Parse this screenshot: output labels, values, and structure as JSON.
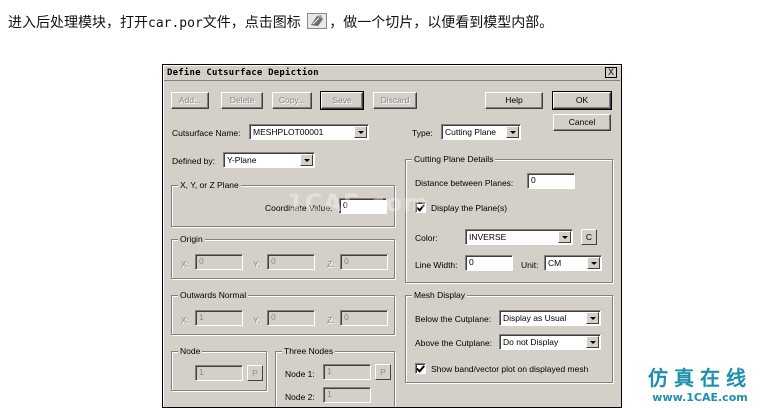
{
  "intro": {
    "part1": "进入后处理模块，打开",
    "filename": "car.por",
    "part2": "文件，点击图标",
    "part3": "，做一个切片，以便看到模型内部。"
  },
  "icons": {
    "inline_tool": "cutsurface-tool-icon",
    "close": "close-icon"
  },
  "dialog": {
    "title": "Define Cutsurface Depiction",
    "close_label": "X",
    "toolbar": {
      "add": "Add...",
      "delete": "Delete",
      "copy": "Copy...",
      "save": "Save",
      "discard": "Discard",
      "help": "Help",
      "ok": "OK",
      "cancel": "Cancel"
    },
    "cutsurface_name": {
      "label": "Cutsurface Name:",
      "value": "MESHPLOT00001"
    },
    "type": {
      "label": "Type:",
      "value": "Cutting Plane"
    },
    "defined_by": {
      "label": "Defined by:",
      "value": "Y-Plane"
    },
    "xyz_plane": {
      "title": "X, Y, or Z Plane",
      "coord_label": "Coordinate Value:",
      "coord_value": "0"
    },
    "origin": {
      "title": "Origin",
      "x_label": "X:",
      "x_value": "0",
      "y_label": "Y:",
      "y_value": "0",
      "z_label": "Z:",
      "z_value": "0"
    },
    "outwards_normal": {
      "title": "Outwards Normal",
      "x_label": "X:",
      "x_value": "1",
      "y_label": "Y:",
      "y_value": "0",
      "z_label": "Z:",
      "z_value": "0"
    },
    "node": {
      "title": "Node",
      "value": "1",
      "pick": "P"
    },
    "three_nodes": {
      "title": "Three Nodes",
      "node1_label": "Node 1:",
      "node1_value": "1",
      "node2_label": "Node 2:",
      "node2_value": "1",
      "pick": "P"
    },
    "cutting_plane_details": {
      "title": "Cutting Plane Details",
      "distance_label": "Distance between Planes:",
      "distance_value": "0",
      "display_plane_label": "Display the Plane(s)",
      "display_plane_checked": true,
      "color_label": "Color:",
      "color_value": "INVERSE",
      "color_button": "C",
      "line_width_label": "Line Width:",
      "line_width_value": "0",
      "unit_label": "Unit:",
      "unit_value": "CM"
    },
    "mesh_display": {
      "title": "Mesh Display",
      "below_label": "Below the Cutplane:",
      "below_value": "Display as Usual",
      "above_label": "Above the Cutplane:",
      "above_value": "Do not Display",
      "band_label": "Show band/vector plot on displayed mesh",
      "band_checked": true
    }
  },
  "watermark": "1CAE.com",
  "brand": {
    "name": "仿真在线",
    "url": "www.1CAE.com",
    "color": "#1f8fae"
  }
}
